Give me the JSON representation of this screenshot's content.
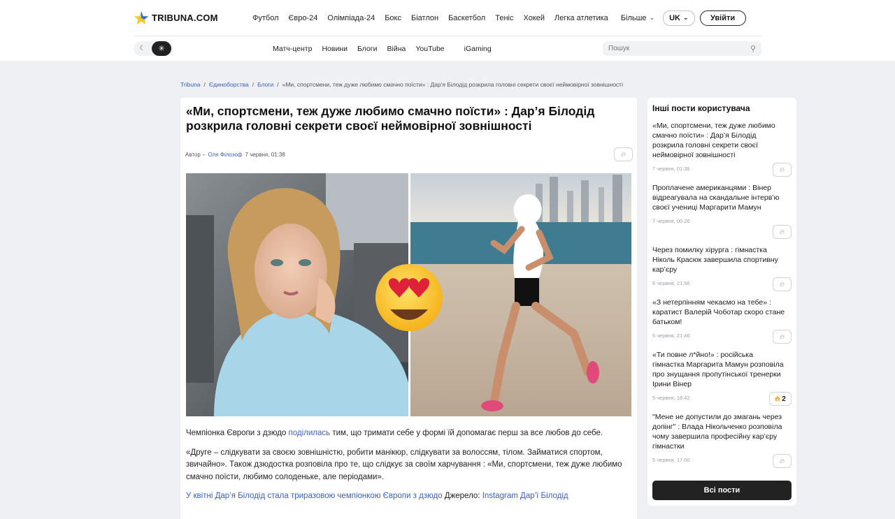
{
  "brand": {
    "name": "TRIBUNA.COM"
  },
  "topnav": [
    "Футбол",
    "Євро-24",
    "Олімпіада-24",
    "Бокс",
    "Біатлон",
    "Баскетбол",
    "Теніс",
    "Хокей",
    "Легка атлетика"
  ],
  "more_label": "Більше",
  "lang_label": "UK",
  "login_label": "Увійти",
  "subnav": [
    "Матч-центр",
    "Новини",
    "Блоги",
    "Війна",
    "YouTube",
    "iGaming"
  ],
  "search": {
    "placeholder": "Пошук"
  },
  "breadcrumbs": [
    "Tribuna",
    "Єдиноборства",
    "Блоги",
    "«Ми, спортсмени, теж дуже любимо смачно поїсти» : Дар'я Білодід розкрила головні секрети своєї неймовірної зовнішності"
  ],
  "article": {
    "title": "«Ми, спортсмени, теж дуже любимо смачно поїсти» : Дар’я Білодід розкрила головні секрети своєї неймовірної зовнішності",
    "author_prefix": "Автор –",
    "author": "Оля Філозоф",
    "date": "7 червня, 01:38",
    "emoji": "😍",
    "p1_before": "Чемпіонка Європи з дзюдо ",
    "p1_link": "поділилась",
    "p1_after": " тим, що тримати себе у формі їй допомагає перш за все любов до себе.",
    "p2": "«Друге – слідкувати за своєю зовнішністю, робити манікюр, слідкувати за волоссям, тілом. Займатися спортом, звичайно». Також дзюдостка розповіла про те, що слідкує за своїм харчування : «Ми, спортсмени, теж дуже любимо смачно поїсти, любимо солоденьке, але періодами».",
    "p3_link": "У квітні Дар’я Білодід стала триразовою чемпіонкою Європи з дзюдо",
    "p3_mid": " Джерело: ",
    "p3_source": "Instagram Дар’ї Білодід"
  },
  "sidebar": {
    "title": "Інші пости користувача",
    "posts": [
      {
        "title": "«Ми, спортсмени, теж дуже любимо смачно поїсти» : Дар’я Білодід розкрила головні секрети своєї неймовірної зовнішності",
        "date": "7 червня, 01:38",
        "likes": ""
      },
      {
        "title": "Проплачене американцями : Вінер відреагувала на скандальне інтерв’ю своєї учениці Маргарити Мамун",
        "date": "7 червня, 00:26",
        "likes": ""
      },
      {
        "title": "Через помилку хірурга : гімнастка Ніколь Красюк завершила спортивну кар’єру",
        "date": "6 червня, 21:56",
        "likes": ""
      },
      {
        "title": "«З нетерпінням чекаємо на тебе» : каратист Валерій Чоботар скоро стане батьком!",
        "date": "5 червня, 21:46",
        "likes": ""
      },
      {
        "title": "«Ти повне л*йно!» : російська гімнастка Маргарита Мамун розповіла про знущання пропутінської тренерки Ірини Вінер",
        "date": "5 червня, 18:42",
        "likes": "2"
      },
      {
        "title": "\"Мене не допустили до змагань через допінг\" : Влада Нікольченко розповіла чому завершила професійну кар’єру гімнастки",
        "date": "5 червня, 17:00",
        "likes": ""
      }
    ],
    "all_posts_label": "Всі пости"
  },
  "icons": {
    "fire": "fire-icon",
    "search": "search-icon",
    "moon": "moon-icon",
    "sun": "sun-icon"
  },
  "colors": {
    "link": "#3a5fc8",
    "dark_button": "#222222",
    "page_bg": "#eef0f3",
    "fire_active": "#f5a623"
  }
}
